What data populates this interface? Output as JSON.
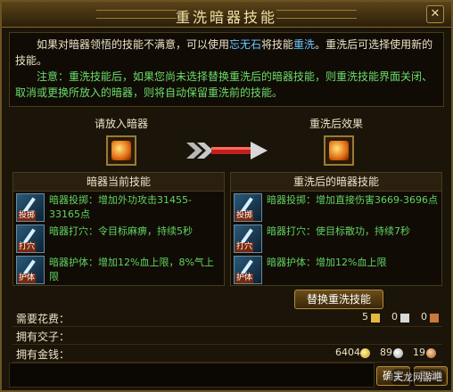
{
  "window": {
    "title": "重洗暗器技能",
    "close_label": "✕"
  },
  "intro": {
    "line1_a": "如果对暗器领悟的技能不满意，可以使用",
    "line1_item": "忘无石",
    "line1_b": "将技能",
    "line1_reset": "重洗",
    "line1_c": "。重洗后可选择使用新的技能。",
    "note": "注意：重洗技能后，如果您尚未选择替换重洗后的暗器技能，则重洗技能界面关闭、取消或更换所放入的暗器，则将自动保留重洗前的技能。"
  },
  "slots": {
    "left_label": "请放入暗器",
    "right_label": "重洗后效果"
  },
  "current_panel": {
    "header": "暗器当前技能",
    "skills": [
      {
        "tag": "投掷",
        "text": "暗器投掷：增加外功攻击31455-33165点"
      },
      {
        "tag": "打穴",
        "text": "暗器打穴：令目标麻痹，持续5秒"
      },
      {
        "tag": "护体",
        "text": "暗器护体：增加12%血上限，8%气上限"
      }
    ]
  },
  "after_panel": {
    "header": "重洗后的暗器技能",
    "skills": [
      {
        "tag": "投掷",
        "text": "暗器投掷：增加直接伤害3669-3696点"
      },
      {
        "tag": "打穴",
        "text": "暗器打穴：使目标散功，持续7秒"
      },
      {
        "tag": "护体",
        "text": "暗器护体：增加12%血上限"
      }
    ]
  },
  "replace_button": "替换重洗技能",
  "rows": {
    "cost_label": "需要花费：",
    "cost": {
      "a": "5",
      "b": "0",
      "c": "0"
    },
    "jiaozi_label": "拥有交子：",
    "money_label": "拥有金钱：",
    "money": {
      "gold": "6404",
      "silver": "89",
      "copper": "19"
    }
  },
  "buttons": {
    "confirm": "确定",
    "cancel": "取消"
  },
  "watermark": "天龙网游吧",
  "colors": {
    "item": "#6cc4ff",
    "note": "#6cdc6c",
    "skill": "#62d262"
  }
}
